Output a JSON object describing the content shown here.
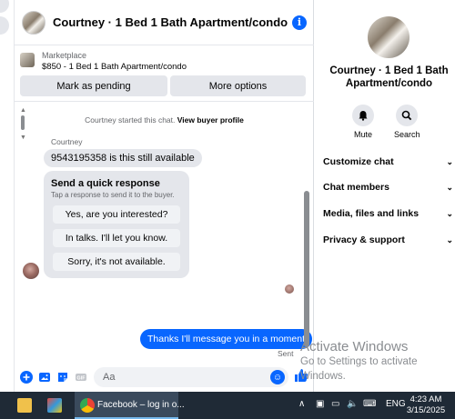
{
  "chat": {
    "title": "Courtney · 1 Bed 1 Bath Apartment/condo",
    "info_icon": "i",
    "listing": {
      "label": "Marketplace",
      "price_title": "$850 - 1 Bed 1 Bath Apartment/condo",
      "mark_pending_label": "Mark as pending",
      "more_options_label": "More options"
    },
    "system_message": "Courtney started this chat.",
    "view_profile_label": "View buyer profile",
    "sender_name": "Courtney",
    "incoming_message": "9543195358 is this still available",
    "quick_response": {
      "title": "Send a quick response",
      "subtitle": "Tap a response to send it to the buyer.",
      "options": [
        "Yes, are you interested?",
        "In talks. I'll let you know.",
        "Sorry, it's not available."
      ]
    },
    "outgoing_message": "Thanks I'll message you in a moment",
    "sent_label": "Sent",
    "composer_placeholder": "Aa"
  },
  "info_panel": {
    "title": "Courtney · 1 Bed 1 Bath Apartment/condo",
    "actions": [
      {
        "label": "Mute",
        "icon": "bell-icon"
      },
      {
        "label": "Search",
        "icon": "search-icon"
      }
    ],
    "sections": [
      "Customize chat",
      "Chat members",
      "Media, files and links",
      "Privacy & support"
    ]
  },
  "watermark": {
    "line1": "Activate Windows",
    "line2": "Go to Settings to activate Windows."
  },
  "taskbar": {
    "active_app_title": "Facebook – log in o...",
    "language": "ENG",
    "time": "4:23 AM",
    "date": "3/15/2025"
  },
  "colors": {
    "accent": "#0866ff",
    "bubble_gray": "#e4e6eb",
    "taskbar": "#1f2a36"
  }
}
